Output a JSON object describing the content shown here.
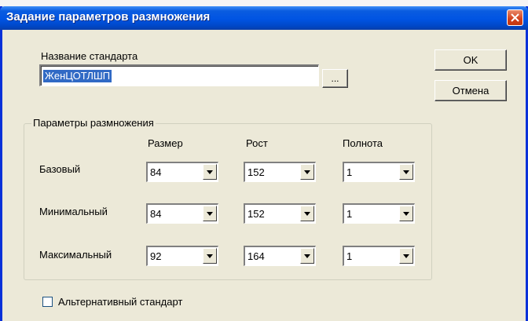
{
  "dialog": {
    "title": "Задание параметров размножения",
    "standard_name_label": "Название стандарта",
    "standard_name_value": "ЖенЦОТЛШП",
    "browse_label": "...",
    "ok_label": "OK",
    "cancel_label": "Отмена",
    "group_label": "Параметры размножения",
    "columns": [
      "Размер",
      "Рост",
      "Полнота"
    ],
    "rows": [
      {
        "label": "Базовый",
        "values": [
          "84",
          "152",
          "1"
        ]
      },
      {
        "label": "Минимальный",
        "values": [
          "84",
          "152",
          "1"
        ]
      },
      {
        "label": "Максимальный",
        "values": [
          "92",
          "164",
          "1"
        ]
      }
    ],
    "alt_standard_label": "Альтернативный стандарт",
    "alt_standard_checked": false
  },
  "icons": {
    "close": "close-icon",
    "dropdown": "chevron-down-icon"
  },
  "colors": {
    "titlebar": "#0054e3",
    "close_button": "#d3401b",
    "window_bg": "#ece9d8",
    "selection": "#316ac5"
  }
}
